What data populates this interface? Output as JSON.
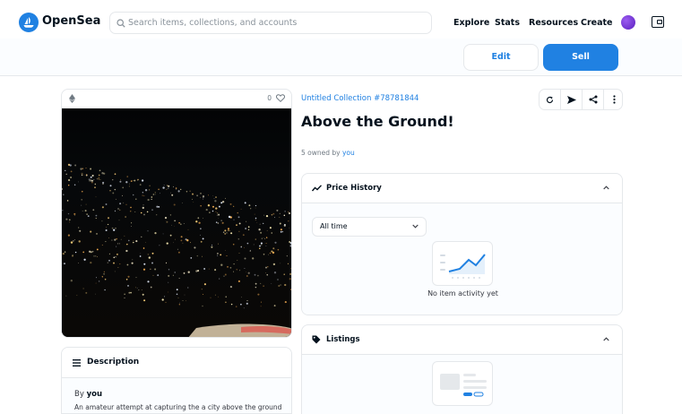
{
  "header": {
    "brand": "OpenSea",
    "search_placeholder": "Search items, collections, and accounts",
    "nav": [
      "Explore",
      "Stats",
      "Resources",
      "Create"
    ]
  },
  "actions": {
    "edit_label": "Edit",
    "sell_label": "Sell"
  },
  "item": {
    "favorites": "0",
    "collection": "Untitled Collection #78781844",
    "title": "Above the Ground!",
    "owned_prefix": "5 owned by",
    "owned_user": "you"
  },
  "description": {
    "title": "Description",
    "by_prefix": "By",
    "by_user": "you",
    "text": "An amateur attempt at capturing the a city above the ground"
  },
  "price_history": {
    "title": "Price History",
    "range_selected": "All time",
    "empty_text": "No item activity yet"
  },
  "listings": {
    "title": "Listings"
  },
  "colors": {
    "accent": "#2081e2",
    "text": "#04111d",
    "border": "#e5e8eb",
    "muted": "#707a83"
  }
}
